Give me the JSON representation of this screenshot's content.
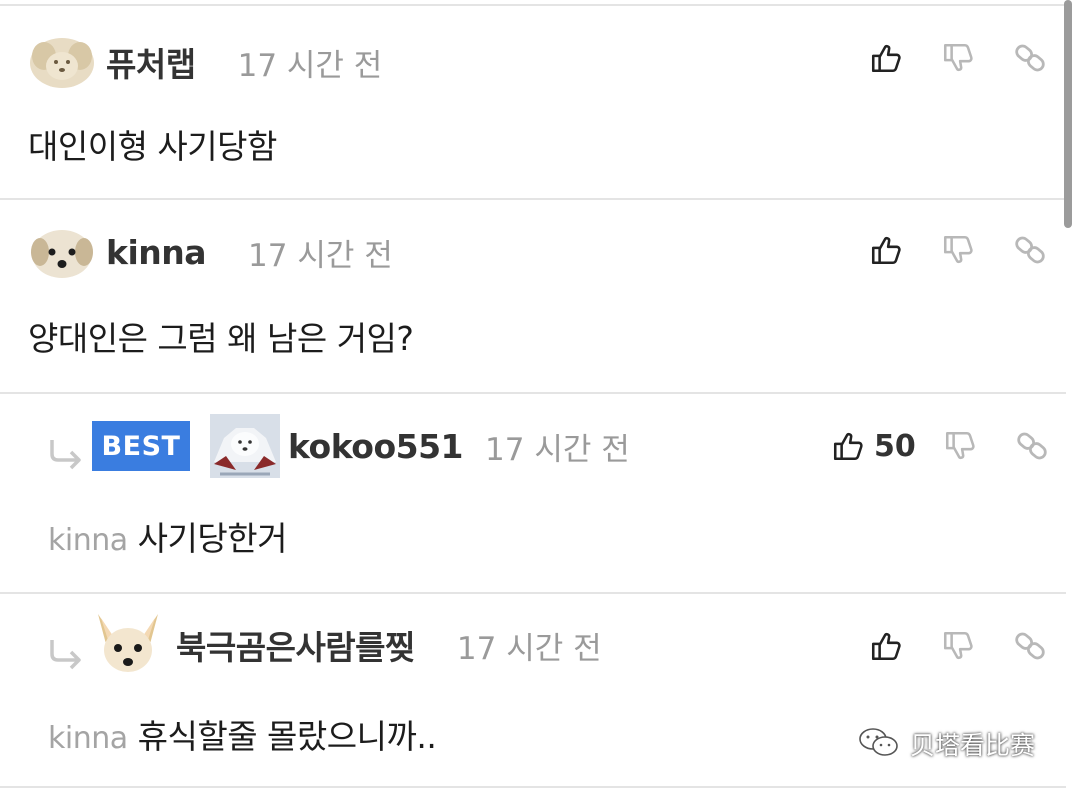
{
  "comments": [
    {
      "nickname": "퓨처랩",
      "time": "17 시간 전",
      "text": "대인이형 사기당함",
      "avatar_icon": "puppy-face-icon"
    },
    {
      "nickname": "kinna",
      "time": "17 시간 전",
      "text": "양대인은 그럼 왜 남은 거임?",
      "avatar_icon": "puppy-face-icon"
    }
  ],
  "replies": [
    {
      "badge": "BEST",
      "nickname": "kokoo551",
      "time": "17 시간 전",
      "like_count": "50",
      "mention": "kinna",
      "text": "사기당한거",
      "avatar_icon": "white-bear-icon"
    },
    {
      "nickname": "북극곰은사람를찢",
      "time": "17 시간 전",
      "mention": "kinna",
      "text": "휴식할줄 몰랐으니까..",
      "avatar_icon": "chihuahua-face-icon"
    }
  ],
  "watermark": {
    "text": "贝塔看比赛",
    "icon": "wechat-icon"
  },
  "colors": {
    "best_badge": "#3a7de0",
    "divider": "#e4e4e4",
    "time": "#9a9a9a"
  }
}
